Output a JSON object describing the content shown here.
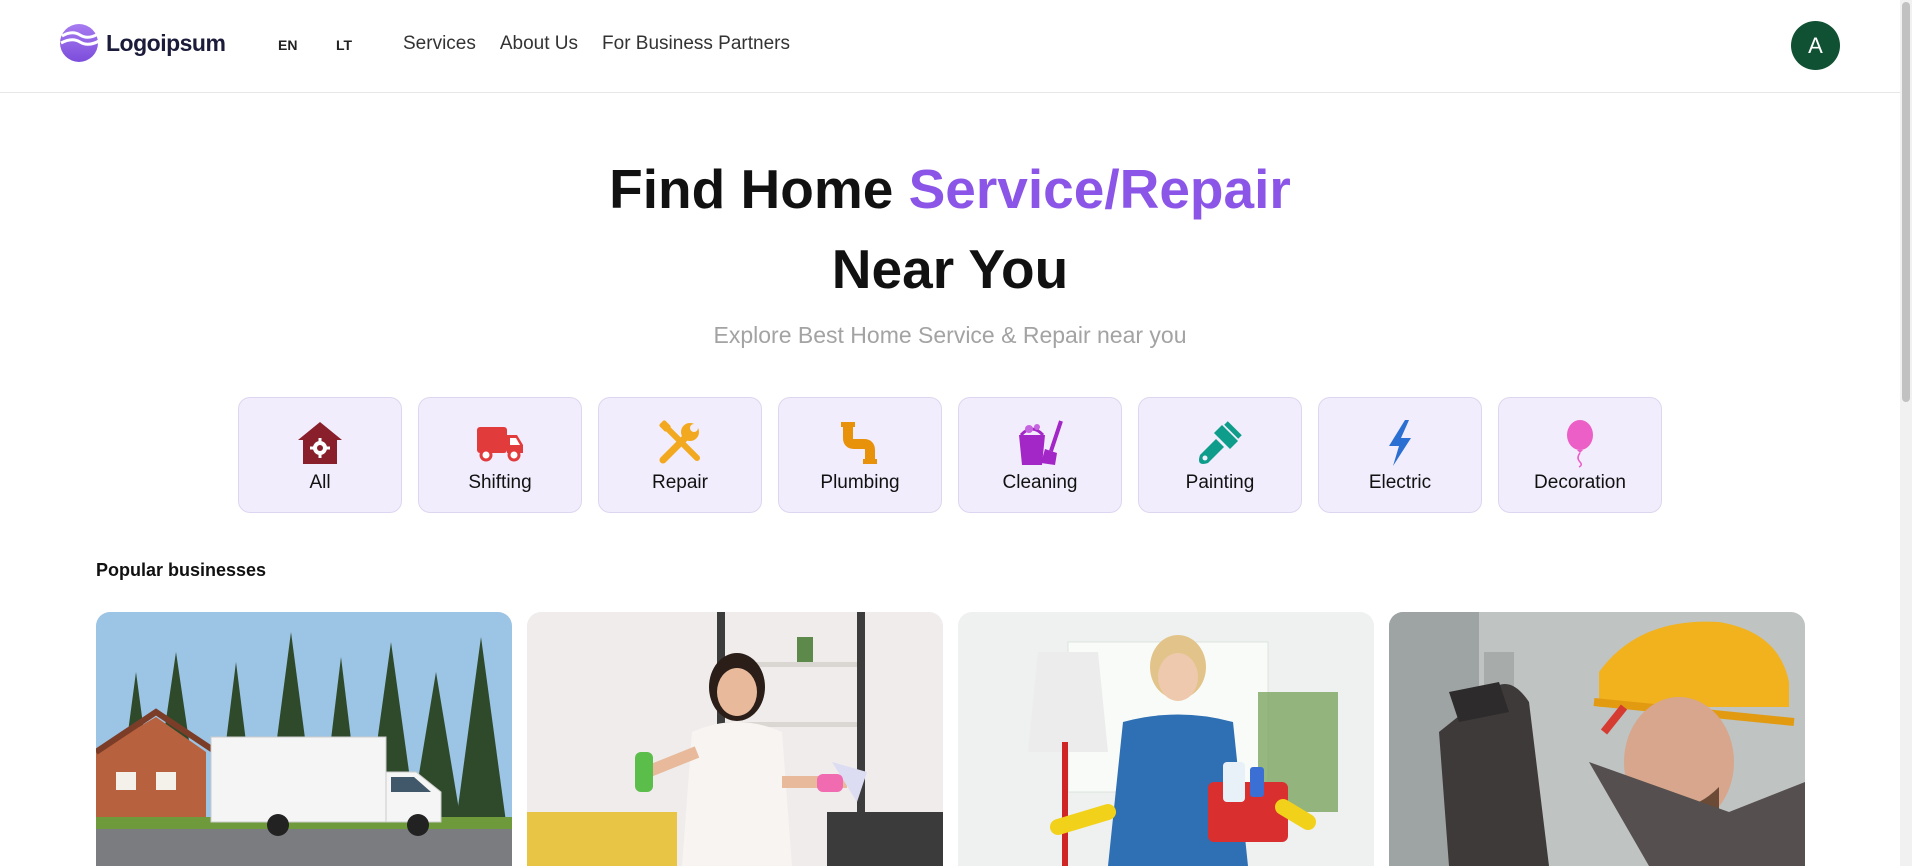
{
  "header": {
    "logo_text": "Logoipsum",
    "languages": [
      "EN",
      "LT"
    ],
    "nav": [
      "Services",
      "About Us",
      "For Business Partners"
    ],
    "avatar_initial": "A"
  },
  "hero": {
    "title_part1": "Find Home ",
    "title_accent": "Service/Repair",
    "title_line2": "Near You",
    "subtitle": "Explore Best Home Service & Repair near you",
    "accent_color": "#8b55e8"
  },
  "categories": [
    {
      "label": "All",
      "icon": "house-gear-icon"
    },
    {
      "label": "Shifting",
      "icon": "truck-icon"
    },
    {
      "label": "Repair",
      "icon": "tools-icon"
    },
    {
      "label": "Plumbing",
      "icon": "pipe-icon"
    },
    {
      "label": "Cleaning",
      "icon": "bucket-broom-icon"
    },
    {
      "label": "Painting",
      "icon": "paint-brush-icon"
    },
    {
      "label": "Electric",
      "icon": "lightning-icon"
    },
    {
      "label": "Decoration",
      "icon": "balloon-icon"
    }
  ],
  "popular": {
    "title": "Popular businesses",
    "cards": [
      {
        "image": "moving-truck-house-photo"
      },
      {
        "image": "woman-cleaning-living-room-photo"
      },
      {
        "image": "woman-with-mop-and-cleaning-supplies-photo"
      },
      {
        "image": "electrician-hard-hat-photo"
      }
    ]
  }
}
